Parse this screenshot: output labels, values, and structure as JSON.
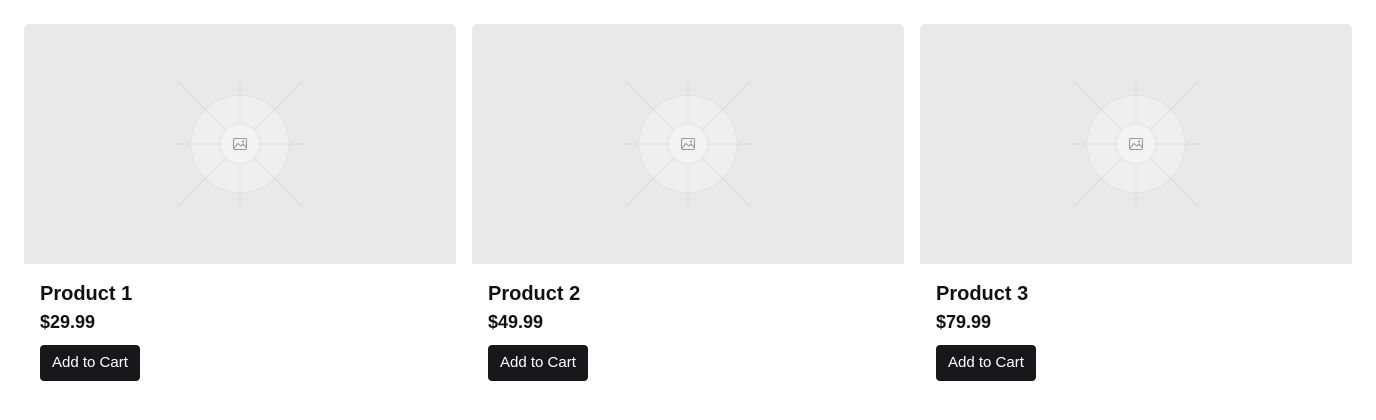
{
  "products": [
    {
      "name": "Product 1",
      "price": "$29.99",
      "cta": "Add to Cart",
      "image_icon": "image-placeholder-icon"
    },
    {
      "name": "Product 2",
      "price": "$49.99",
      "cta": "Add to Cart",
      "image_icon": "image-placeholder-icon"
    },
    {
      "name": "Product 3",
      "price": "$79.99",
      "cta": "Add to Cart",
      "image_icon": "image-placeholder-icon"
    }
  ],
  "colors": {
    "image_bg": "#e9e9e9",
    "button_bg": "#18181b",
    "button_text": "#ffffff",
    "text": "#111111"
  }
}
